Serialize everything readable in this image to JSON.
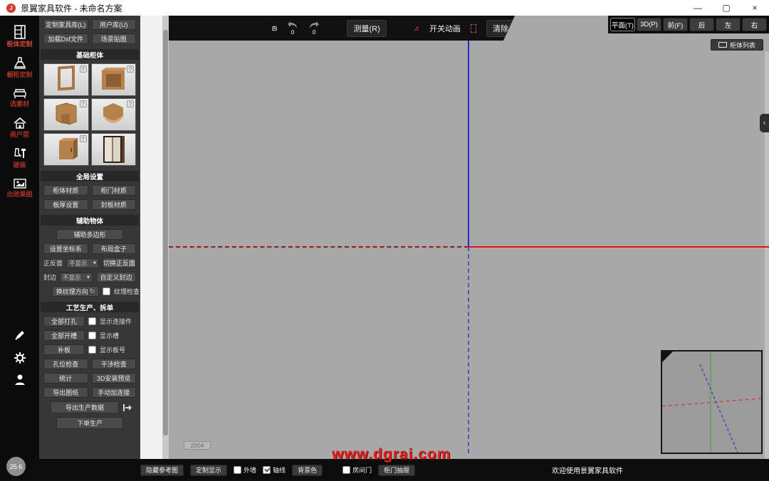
{
  "title_bar": {
    "title": "景翼家具软件 - 未命名方案",
    "minimize": "—",
    "maximize": "▢",
    "close": "×"
  },
  "rail": {
    "tools": [
      {
        "label": "柜体定制"
      },
      {
        "label": "橱柜定制"
      },
      {
        "label": "选素材"
      },
      {
        "label": "画户型"
      },
      {
        "label": "硬装"
      },
      {
        "label": "出效果图"
      }
    ],
    "version": "25.6"
  },
  "panel": {
    "top_buttons": [
      "定制家具库(L)",
      "用户库(U)",
      "加载Dxf文件",
      "场景贴图"
    ],
    "basic": {
      "header": "基础柜体",
      "badge": "?"
    },
    "global": {
      "header": "全局设置",
      "buttons": [
        "柜体材质",
        "柜门材质",
        "板厚设置",
        "封板材质"
      ]
    },
    "aux": {
      "header": "辅助物体",
      "polygon": "辅助多边形",
      "coord": "设置坐标系",
      "layout": "布局盒子",
      "fb_label": "正反面",
      "fb_value": "不显示",
      "switch": "切换正反面",
      "edge_label": "封边",
      "edge_value": "不显示",
      "custom_edge": "自定义封边",
      "texture_dir": "换纹理方向",
      "texture_cycle": "↻",
      "texture_check": "纹理检查"
    },
    "process": {
      "header": "工艺生产、拆单",
      "drill": "全部打孔",
      "show_connector": "显示连接件",
      "slot": "全部开槽",
      "show_slot": "显示槽",
      "patch": "补板",
      "show_board": "显示板号",
      "hole_check": "孔位检查",
      "interference": "干涉检查",
      "stats": "统计",
      "preview3d": "3D安装预览",
      "export_draw": "导出图纸",
      "manual_conn": "手动加连接",
      "export_data": "导出生产数据",
      "order": "下单生产"
    }
  },
  "toolbar": {
    "undo_count": "0",
    "redo_count": "0",
    "measure": "测量(R)",
    "anim": "开关动画",
    "clear": "清除"
  },
  "viewbar": {
    "buttons": [
      "平面(T)",
      "3D(P)",
      "前(F)",
      "后",
      "左",
      "右"
    ],
    "active": "平面(T)",
    "cabinet_list": "柜体列表"
  },
  "canvas": {
    "scale_label": "2004",
    "watermark": "www.dgrai.com"
  },
  "status": {
    "ref_btn": "隐藏参考图",
    "display_btn": "定制显示",
    "outer_wall": "外墙",
    "axis_lines": "轴线",
    "bg_color": "背景色",
    "room_door": "房间门",
    "door_drawer": "柜门抽屉",
    "welcome": "欢迎使用景翼家具软件"
  },
  "colors": {
    "accent_red": "#d3392c",
    "axis_red": "#f21212",
    "axis_blue": "#2a2ac8",
    "watermark_red": "#e01f1f",
    "wood": "#b5824c"
  }
}
